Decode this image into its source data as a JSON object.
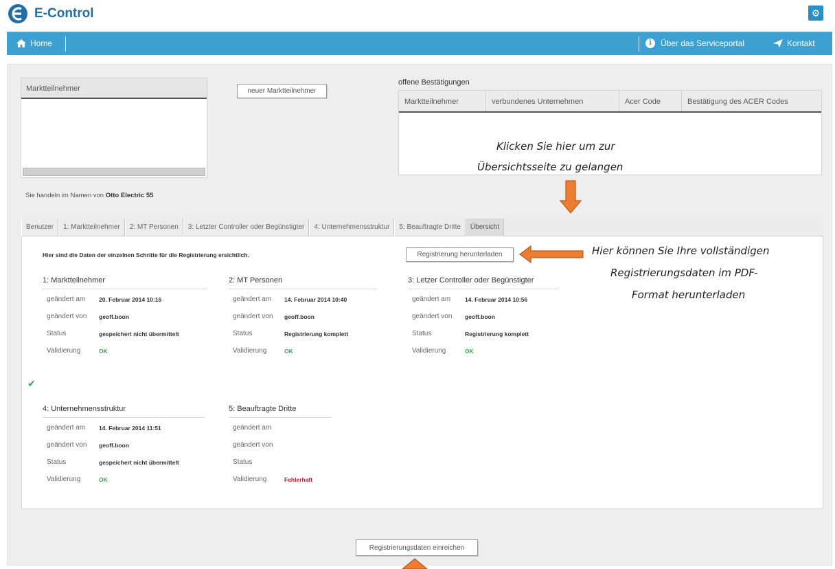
{
  "app": {
    "name": "E-Control"
  },
  "nav": {
    "home": "Home",
    "about": "Über das Serviceportal",
    "contact": "Kontakt"
  },
  "marktteilnehmer_panel": {
    "header": "Marktteilnehmer",
    "new_button": "neuer Marktteilnehmer"
  },
  "open_confirmations": {
    "title": "offene Bestätigungen",
    "columns": [
      "Marktteilnehmer",
      "verbundenes Unternehmen",
      "Acer Code",
      "Bestätigung des ACER Codes"
    ]
  },
  "acting_as": {
    "label": "Sie handeln im Namen von",
    "name": "Otto Electric 55"
  },
  "tabs": [
    {
      "label": "Benutzer"
    },
    {
      "label": "1: Marktteilnehmer"
    },
    {
      "label": "2: MT Personen"
    },
    {
      "label": "3: Letzter Controller oder Begünstigter"
    },
    {
      "label": "4: Unternehmensstruktur"
    },
    {
      "label": "5: Beauftragte Dritte"
    },
    {
      "label": "Übersicht",
      "active": true
    }
  ],
  "overview": {
    "info_text": "Hier sind die Daten der einzelnen Schritte für die Registrierung ersichtlich.",
    "download_button": "Registrierung herunterladen",
    "labels": {
      "changed_at": "geändert am",
      "changed_by": "geändert von",
      "status": "Status",
      "validation": "Validierung"
    },
    "sections": [
      {
        "title": "1: Marktteilnehmer",
        "changed_at": "20. Februar 2014 10:16",
        "changed_by": "geoff.boon",
        "status": "gespeichert nicht übermittelt",
        "validation": "OK"
      },
      {
        "title": "2: MT Personen",
        "changed_at": "14. Februar 2014 10:40",
        "changed_by": "geoff.boon",
        "status": "Registrierung komplett",
        "validation": "OK"
      },
      {
        "title": "3: Letzer Controller oder Begünstigter",
        "changed_at": "14. Februar 2014 10:56",
        "changed_by": "geoff.boon",
        "status": "Registrierung komplett",
        "validation": "OK"
      },
      {
        "title": "4: Unternehmensstruktur",
        "changed_at": "14. Februar 2014 11:51",
        "changed_by": "geoff.boon",
        "status": "gespeichert nicht übermittelt",
        "validation": "OK"
      },
      {
        "title": "5: Beauftragte Dritte",
        "changed_at": "",
        "changed_by": "",
        "status": "",
        "validation": "Fehlerhaft"
      }
    ]
  },
  "submit_button": "Registrierungsdaten einreichen",
  "annotations": {
    "overview_hint_line1": "Klicken Sie hier um zur",
    "overview_hint_line2": "Übersichtsseite zu gelangen",
    "download_hint_line1": "Hier können Sie Ihre vollständigen",
    "download_hint_line2": "Registrierungsdaten im PDF-",
    "download_hint_line3": "Format herunterladen"
  },
  "colors": {
    "nav_blue": "#3ca0d0",
    "logo_blue": "#1f6fa6",
    "arrow_orange": "#ed7d31",
    "ok_green": "#3aa84a",
    "error_red": "#b21f24"
  },
  "icons": [
    "home-icon",
    "gear-icon",
    "info-icon",
    "paper-plane-icon",
    "checkmark-icon",
    "arrow-down-icon",
    "arrow-left-icon",
    "arrow-up-icon"
  ]
}
